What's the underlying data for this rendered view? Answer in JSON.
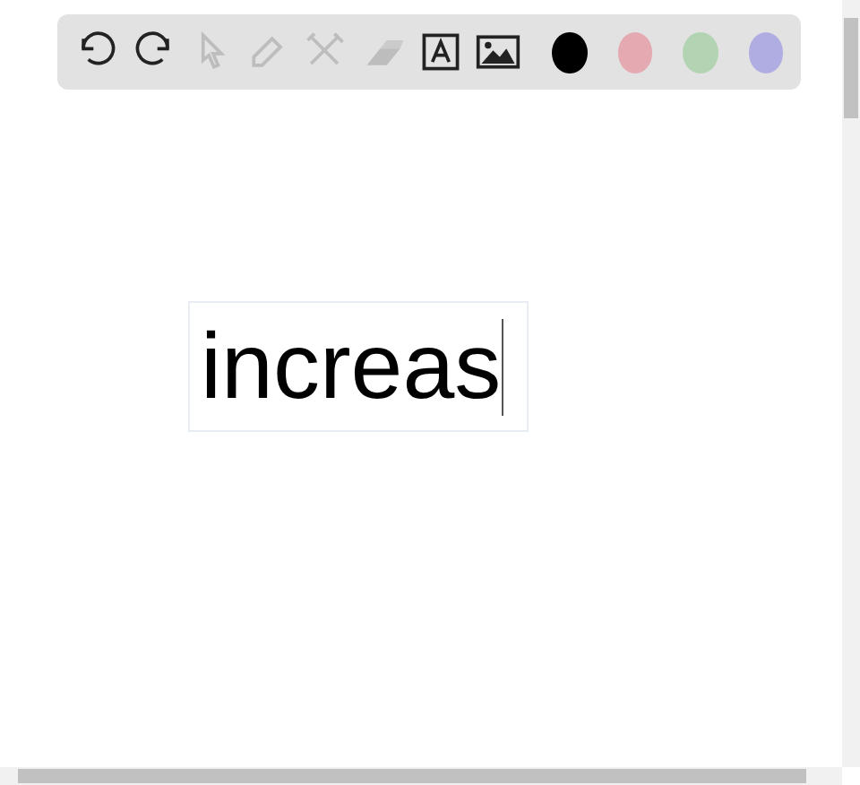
{
  "toolbar": {
    "tools": [
      {
        "kind": "undo",
        "disabled": false
      },
      {
        "kind": "redo",
        "disabled": false
      },
      {
        "kind": "pointer",
        "disabled": true
      },
      {
        "kind": "pen",
        "disabled": true
      },
      {
        "kind": "tools",
        "disabled": true
      },
      {
        "kind": "eraser",
        "disabled": true
      },
      {
        "kind": "text",
        "disabled": false
      },
      {
        "kind": "image",
        "disabled": false
      }
    ],
    "colors": [
      {
        "color": "#000000"
      },
      {
        "color": "#e5a9b1"
      },
      {
        "color": "#b3d4b3"
      },
      {
        "color": "#b0ade3"
      }
    ]
  },
  "canvas": {
    "text_box": {
      "text": "increas"
    }
  }
}
